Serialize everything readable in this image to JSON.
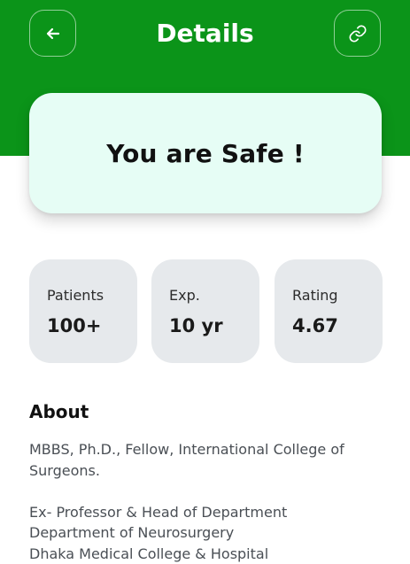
{
  "header": {
    "title": "Details",
    "background_color": "#0b9419",
    "back_icon": "arrow-left-icon",
    "link_icon": "link-icon"
  },
  "status_card": {
    "message": "You are Safe !",
    "background_color": "#e6fdf5"
  },
  "stats": [
    {
      "label": "Patients",
      "value": "100+"
    },
    {
      "label": "Exp.",
      "value": "10 yr"
    },
    {
      "label": "Rating",
      "value": "4.67"
    }
  ],
  "about": {
    "title": "About",
    "paragraph1": "MBBS, Ph.D., Fellow, International College of Surgeons.",
    "line1": "Ex- Professor & Head of Department",
    "line2": "Department of Neurosurgery",
    "line3": "Dhaka Medical College & Hospital"
  }
}
